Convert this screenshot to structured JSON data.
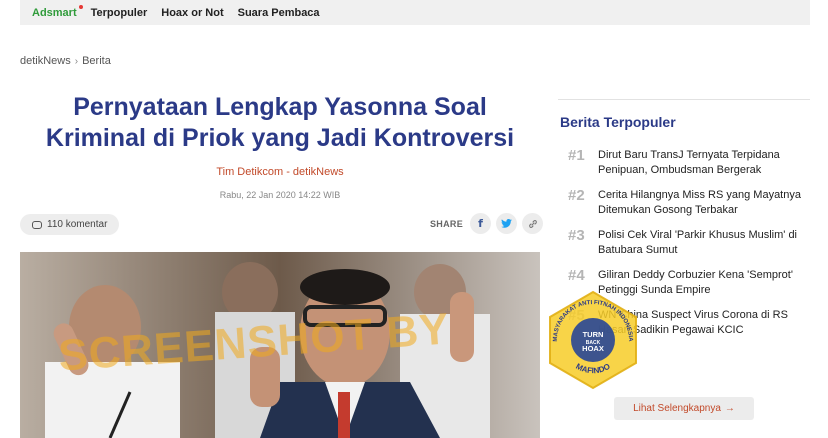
{
  "topnav": {
    "items": [
      "Adsmart",
      "Terpopuler",
      "Hoax or Not",
      "Suara Pembaca"
    ]
  },
  "breadcrumb": {
    "items": [
      "detikNews",
      "Berita"
    ],
    "separator": "›"
  },
  "article": {
    "title_line1": "Pernyataan Lengkap Yasonna Soal",
    "title_line2": "Kriminal di Priok yang Jadi Kontroversi",
    "author": "Tim Detikcom - detikNews",
    "date": "Rabu, 22 Jan 2020 14:22 WIB",
    "comment_count": "110 komentar",
    "share_label": "SHARE"
  },
  "sidebar": {
    "title": "Berita Terpopuler",
    "items": [
      {
        "num": "#1",
        "text": "Dirut Baru TransJ Ternyata Terpidana Penipuan, Ombudsman Bergerak"
      },
      {
        "num": "#2",
        "text": "Cerita Hilangnya Miss RS yang Mayatnya Ditemukan Gosong Terbakar"
      },
      {
        "num": "#3",
        "text": "Polisi Cek Viral 'Parkir Khusus Muslim' di Batubara Sumut"
      },
      {
        "num": "#4",
        "text": "Giliran Deddy Corbuzier Kena 'Semprot' Petinggi Sunda Empire"
      },
      {
        "num": "#5",
        "text": "WN China Suspect Virus Corona di RS Hasan Sadikin Pegawai KCIC"
      }
    ],
    "more_label": "Lihat Selengkapnya",
    "more_arrow": "→"
  },
  "watermark": {
    "text": "SCREENSHOT BY",
    "seal_text_outer": "MASYARAKAT ANTI FITNAH INDONESIA",
    "seal_text_center": "TURN BACK HOAX",
    "seal_text_bottom": "MAFINDO"
  },
  "colors": {
    "title_blue": "#2b3a87",
    "accent_red": "#c24a2a",
    "adsmart_green": "#2f9b3a",
    "watermark_orange": "#f0aa1e"
  },
  "icons": {
    "comment": "comment-bubble-icon",
    "facebook": "facebook-icon",
    "twitter": "twitter-icon",
    "link": "link-icon",
    "breadcrumb_sep": "chevron-right-icon"
  }
}
